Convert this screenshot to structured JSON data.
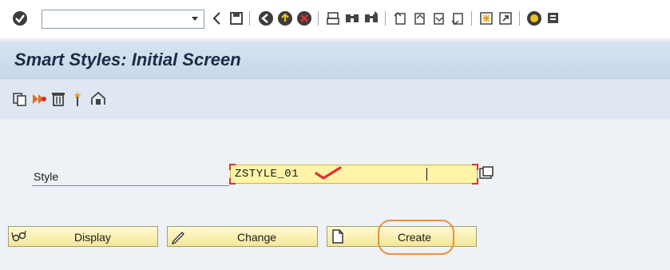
{
  "toolbar": {
    "command_value": "",
    "icons": [
      "enter-icon",
      "dropdown-icon",
      "back-icon",
      "save-icon",
      "back-green-icon",
      "exit-icon",
      "cancel-icon",
      "print-icon",
      "find-icon",
      "find-next-icon",
      "first-page-icon",
      "prev-page-icon",
      "next-page-icon",
      "last-page-icon",
      "new-session-icon",
      "shortcut-icon",
      "help-icon",
      "layout-icon"
    ]
  },
  "title": "Smart Styles: Initial Screen",
  "app_toolbar": {
    "icons": [
      "copy-icon",
      "rename-icon",
      "delete-icon",
      "test-icon",
      "transport-icon"
    ]
  },
  "form": {
    "style_label": "Style",
    "style_value": "ZSTYLE_01"
  },
  "buttons": {
    "display": "Display",
    "change": "Change",
    "create": "Create"
  },
  "colors": {
    "field_bg": "#fff3a8",
    "button_bg": "#f5e79a",
    "highlight": "#e8903a",
    "check": "#e03030"
  }
}
